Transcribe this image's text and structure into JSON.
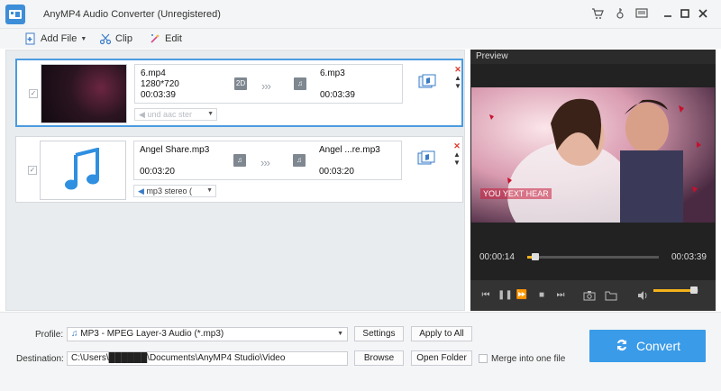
{
  "window": {
    "title": "AnyMP4 Audio Converter (Unregistered)",
    "controls": [
      "cart-icon",
      "key-icon",
      "feedback-icon",
      "minimize-icon",
      "maximize-icon",
      "close-icon"
    ]
  },
  "toolbar": {
    "add_file": "Add File",
    "clip": "Clip",
    "edit": "Edit"
  },
  "files": [
    {
      "src_name": "6.mp4",
      "src_res": "1280*720",
      "src_duration": "00:03:39",
      "src_badge": "2D",
      "dst_name": "6.mp3",
      "dst_duration": "00:03:39",
      "audio_track": "und aac ster",
      "checked": true,
      "selected": true
    },
    {
      "src_name": "Angel Share.mp3",
      "src_duration": "00:03:20",
      "dst_name": "Angel ...re.mp3",
      "dst_duration": "00:03:20",
      "audio_track": "mp3 stereo (",
      "checked": true,
      "selected": false
    }
  ],
  "preview": {
    "title": "Preview",
    "overlay_text": "YOU YEXT HEAR",
    "time_current": "00:00:14",
    "time_total": "00:03:39",
    "progress": 0.064,
    "volume": 0.9
  },
  "bottom": {
    "profile_label": "Profile:",
    "profile_value": "MP3 - MPEG Layer-3 Audio (*.mp3)",
    "settings": "Settings",
    "apply_to_all": "Apply to All",
    "destination_label": "Destination:",
    "destination_value": "C:\\Users\\██████\\Documents\\AnyMP4 Studio\\Video",
    "browse": "Browse",
    "open_folder": "Open Folder",
    "merge": "Merge into one file",
    "convert": "Convert"
  },
  "colors": {
    "accent": "#3a9be8",
    "progress": "#f5b21a",
    "selection_border": "#4a9be0",
    "delete_red": "#e0392b"
  }
}
